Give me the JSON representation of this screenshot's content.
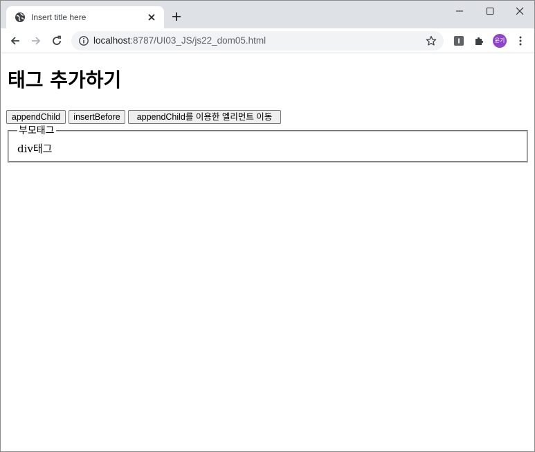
{
  "browser": {
    "tab_title": "Insert title here",
    "url_host": "localhost",
    "url_rest": ":8787/UI03_JS/js22_dom05.html",
    "profile_initials": "윤기"
  },
  "page": {
    "heading": "태그 추가하기",
    "buttons": {
      "append_child": "appendChild",
      "insert_before": "insertBefore",
      "move": "appendChild를 이용한 엘리먼트 이동"
    },
    "fieldset_legend": "부모태그",
    "div_text": "div태그"
  },
  "colors": {
    "tabstrip": "#dee1e6",
    "omnibox": "#f1f3f4",
    "profile": "#8e44c8"
  }
}
